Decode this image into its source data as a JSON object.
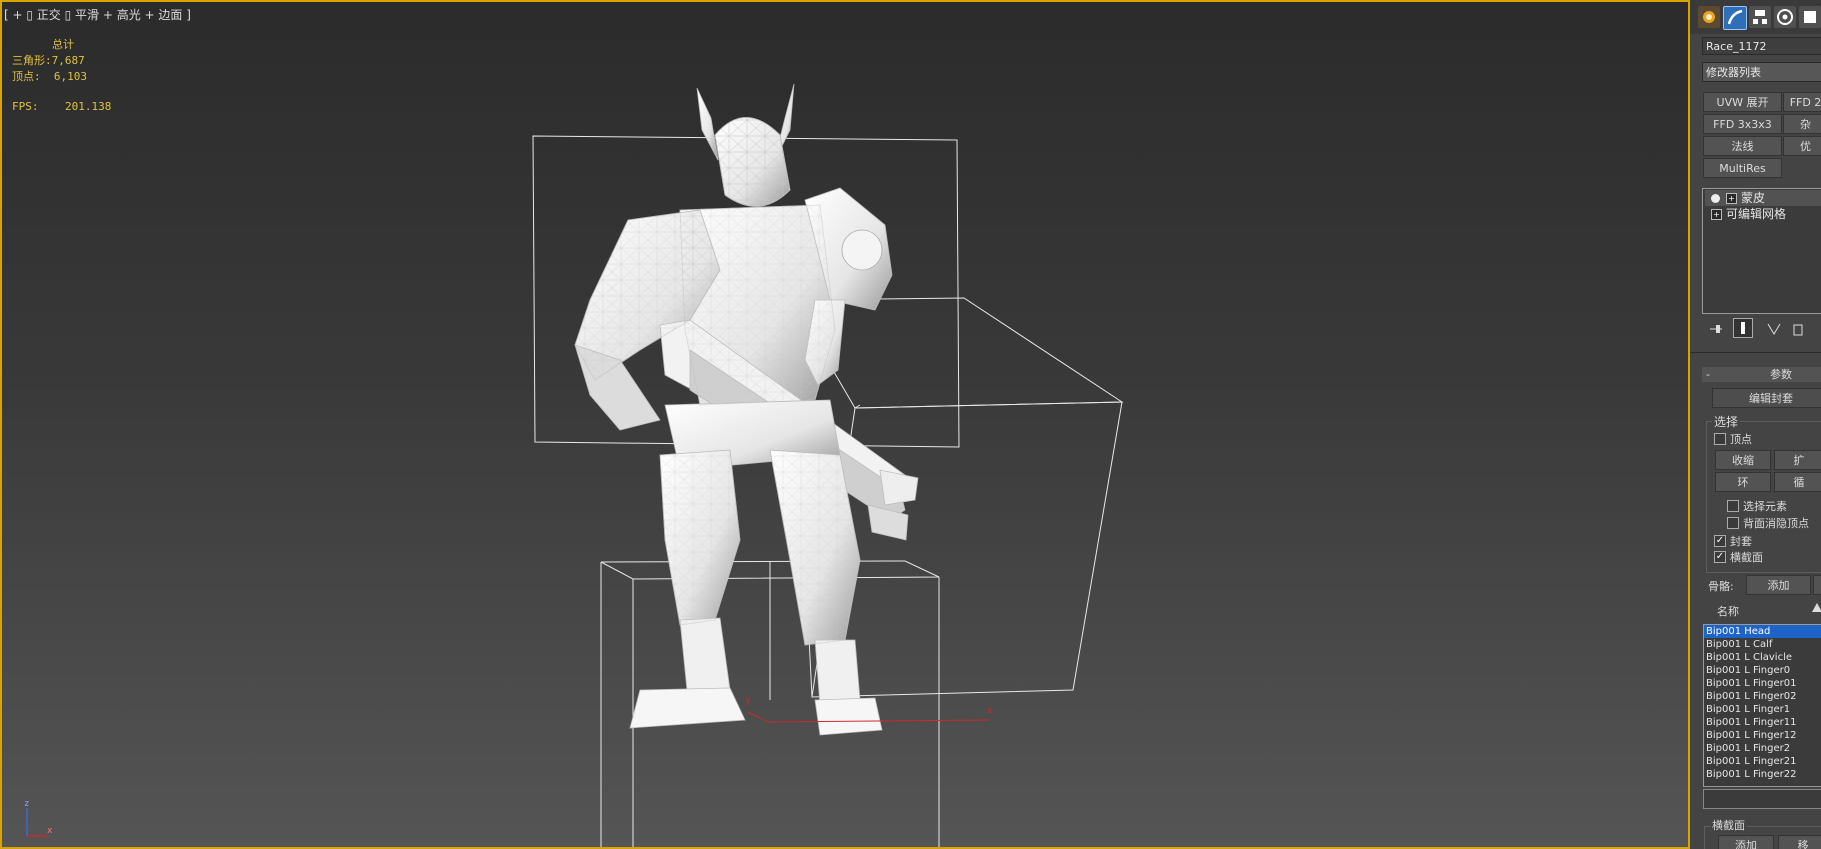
{
  "viewport": {
    "label": [
      "[ + ]",
      "[ 正交 ]",
      "[ 平滑 + 高光 + 边面 ]"
    ],
    "label_text": "[ + ▯ 正交 ▯ 平滑 + 高光 + 边面 ]",
    "stats": {
      "total_label": "总计",
      "triangles_label": "三角形:",
      "triangles_value": "7,687",
      "vertices_label": "顶点:",
      "vertices_value": "6,103",
      "fps_label": "FPS:",
      "fps_value": "201.138"
    },
    "axis_icon": {
      "z": "z",
      "x": "x"
    },
    "gizmo": {
      "x": "x",
      "y": "y"
    },
    "colors": {
      "accent_border": "#d8a400",
      "stats_text": "#e0c040",
      "gizmo_axis": "#cc2a2a"
    }
  },
  "panel": {
    "tab_icons": [
      "create-icon",
      "modify-icon",
      "hierarchy-icon",
      "motion-icon",
      "display-icon"
    ],
    "object_name": "Race_1172",
    "modifier_list": "修改器列表",
    "modifier_buttons": [
      "UVW 展开",
      "FFD 2",
      "FFD 3x3x3",
      "杂",
      "法线",
      "优",
      "MultiRes"
    ],
    "stack": [
      {
        "label": "蒙皮",
        "icons": [
          "lightbulb-icon",
          "expand-icon"
        ]
      },
      {
        "label": "可编辑网格",
        "icons": [
          "expand-icon"
        ]
      }
    ],
    "stack_tool_icons": [
      "pin-stack-icon",
      "show-end-result-icon",
      "make-unique-icon",
      "remove-modifier-icon"
    ],
    "rollout": {
      "collapse": "-",
      "title": "参数",
      "edit_envelopes": "编辑封套",
      "select_group": "选择",
      "vertices_label": "顶点",
      "vertices_checked": false,
      "shrink": "收缩",
      "grow": "扩",
      "ring": "环",
      "loop": "循",
      "select_element": "选择元素",
      "select_element_checked": false,
      "backface_cull": "背面消隐顶点",
      "backface_cull_checked": false,
      "envelopes": "封套",
      "envelopes_checked": true,
      "cross_sections": "横截面",
      "cross_sections_checked": true,
      "bones_label": "骨骼:",
      "add_button": "添加",
      "name_header": "名称"
    },
    "bones": [
      "Bip001 Head",
      "Bip001 L Calf",
      "Bip001 L Clavicle",
      "Bip001 L Finger0",
      "Bip001 L Finger01",
      "Bip001 L Finger02",
      "Bip001 L Finger1",
      "Bip001 L Finger11",
      "Bip001 L Finger12",
      "Bip001 L Finger2",
      "Bip001 L Finger21",
      "Bip001 L Finger22"
    ],
    "selected_bone": "Bip001 Head",
    "cross_section_group": "横截面",
    "cross_section_add": "添加",
    "cross_section_remove": "移"
  }
}
